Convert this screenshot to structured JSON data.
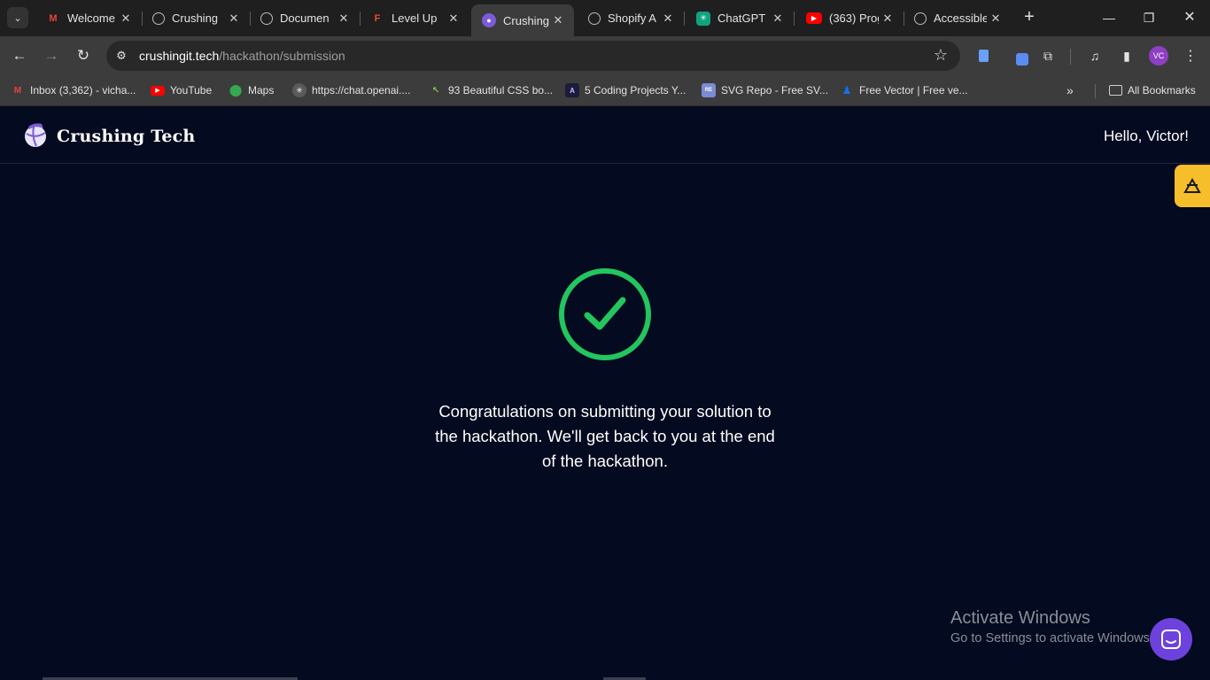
{
  "browser": {
    "tabs": [
      {
        "title": "Welcome",
        "favicon": "gmail-icon",
        "active": false
      },
      {
        "title": "Crushing",
        "favicon": "globe-icon",
        "active": false
      },
      {
        "title": "Documen",
        "favicon": "globe-icon",
        "active": false
      },
      {
        "title": "Level Up",
        "favicon": "figma-icon",
        "active": false
      },
      {
        "title": "Crushing",
        "favicon": "crushing-tech-icon",
        "active": true
      },
      {
        "title": "Shopify A",
        "favicon": "globe-icon",
        "active": false
      },
      {
        "title": "ChatGPT",
        "favicon": "chatgpt-icon",
        "active": false
      },
      {
        "title": "(363) Prog",
        "favicon": "youtube-icon",
        "active": false
      },
      {
        "title": "Accessible",
        "favicon": "globe-icon",
        "active": false
      }
    ],
    "url_host": "crushingit.tech",
    "url_path": "/hackathon/submission",
    "profile_initials": "VC",
    "bookmarks": [
      {
        "label": "Inbox (3,362) - vicha...",
        "icon": "gmail-icon"
      },
      {
        "label": "YouTube",
        "icon": "youtube-icon"
      },
      {
        "label": "Maps",
        "icon": "maps-icon"
      },
      {
        "label": "https://chat.openai....",
        "icon": "chatgpt-icon"
      },
      {
        "label": "93 Beautiful CSS bo...",
        "icon": "cursor-icon"
      },
      {
        "label": "5 Coding Projects Y...",
        "icon": "code-icon"
      },
      {
        "label": "SVG Repo - Free SV...",
        "icon": "svgrepo-icon"
      },
      {
        "label": "Free Vector | Free ve...",
        "icon": "freepik-icon"
      }
    ],
    "all_bookmarks_label": "All Bookmarks",
    "colors": {
      "tab_strip": "#1f1f1f",
      "toolbar": "#3c3c3c"
    }
  },
  "site": {
    "brand": "Crushing Tech",
    "greeting": "Hello, Victor!",
    "message": "Congratulations on submitting your solution to the hackathon. We'll get back to you at the end of the hackathon.",
    "colors": {
      "background": "#040a1f",
      "success": "#22c55e",
      "badge": "#f7be2c",
      "chat": "#6d42dc"
    }
  },
  "os_watermark": {
    "line1": "Activate Windows",
    "line2": "Go to Settings to activate Windows."
  }
}
